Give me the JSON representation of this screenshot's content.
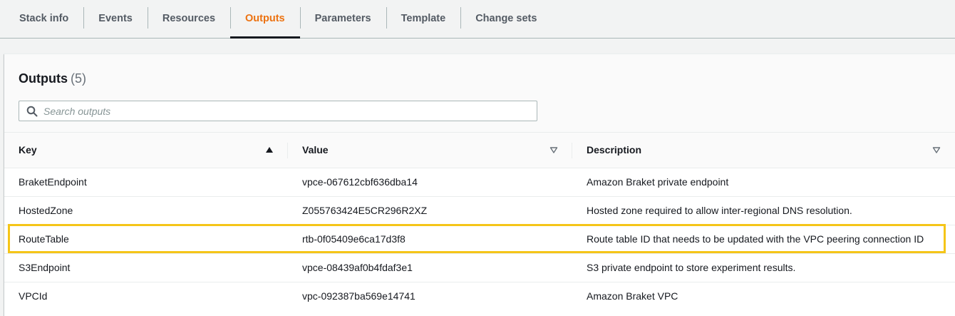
{
  "tabs": [
    {
      "label": "Stack info",
      "active": false
    },
    {
      "label": "Events",
      "active": false
    },
    {
      "label": "Resources",
      "active": false
    },
    {
      "label": "Outputs",
      "active": true
    },
    {
      "label": "Parameters",
      "active": false
    },
    {
      "label": "Template",
      "active": false
    },
    {
      "label": "Change sets",
      "active": false
    }
  ],
  "outputs": {
    "title": "Outputs",
    "count": "(5)",
    "search_placeholder": "Search outputs",
    "columns": {
      "key": "Key",
      "value": "Value",
      "description": "Description"
    },
    "rows": [
      {
        "key": "BraketEndpoint",
        "value": "vpce-067612cbf636dba14",
        "description": "Amazon Braket private endpoint"
      },
      {
        "key": "HostedZone",
        "value": "Z055763424E5CR296R2XZ",
        "description": "Hosted zone required to allow inter-regional DNS resolution."
      },
      {
        "key": "RouteTable",
        "value": "rtb-0f05409e6ca17d3f8",
        "description": "Route table ID that needs to be updated with the VPC peering connection ID"
      },
      {
        "key": "S3Endpoint",
        "value": "vpce-08439af0b4fdaf3e1",
        "description": "S3 private endpoint to store experiment results."
      },
      {
        "key": "VPCId",
        "value": "vpc-092387ba569e14741",
        "description": "Amazon Braket VPC"
      }
    ],
    "highlighted_row": "RouteTable"
  },
  "colors": {
    "active_tab": "#ec7211",
    "highlight": "#f5c518"
  }
}
